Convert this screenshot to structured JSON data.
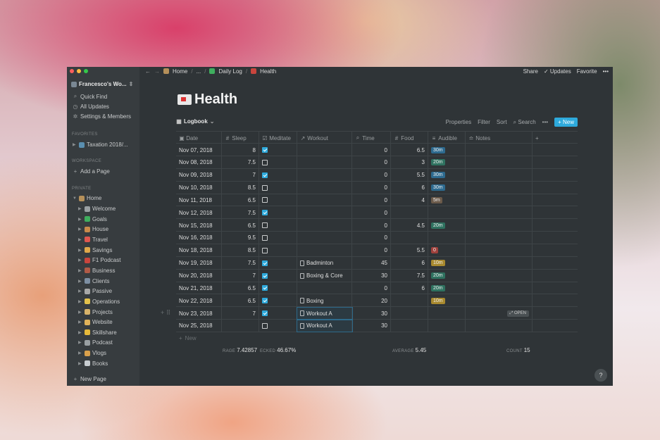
{
  "sidebar": {
    "workspace": "Francesco's Wo...",
    "top_items": [
      {
        "label": "Quick Find"
      },
      {
        "label": "All Updates"
      },
      {
        "label": "Settings & Members"
      }
    ],
    "favorites_heading": "FAVORITES",
    "favorites": [
      {
        "label": "Taxation 2018/..."
      }
    ],
    "workspace_heading": "WORKSPACE",
    "add_page": "Add a Page",
    "private_heading": "PRIVATE",
    "home": "Home",
    "private_items": [
      {
        "label": "Welcome",
        "color": "#9aa0a3"
      },
      {
        "label": "Goals",
        "color": "#3fae5e"
      },
      {
        "label": "House",
        "color": "#c98a4b"
      },
      {
        "label": "Travel",
        "color": "#e0574f"
      },
      {
        "label": "Savings",
        "color": "#e0a84a"
      },
      {
        "label": "F1 Podcast",
        "color": "#c9453d"
      },
      {
        "label": "Business",
        "color": "#b05a47"
      },
      {
        "label": "Clients",
        "color": "#7d8fa3"
      },
      {
        "label": "Passive",
        "color": "#a8a8a8"
      },
      {
        "label": "Operations",
        "color": "#e3c14b"
      },
      {
        "label": "Projects",
        "color": "#d8b36a"
      },
      {
        "label": "Website",
        "color": "#e0b25a"
      },
      {
        "label": "Skillshare",
        "color": "#e6b93a"
      },
      {
        "label": "Podcast",
        "color": "#9aa0a3"
      },
      {
        "label": "Vlogs",
        "color": "#d9a04b"
      },
      {
        "label": "Books",
        "color": "#c7ccd0"
      }
    ],
    "new_page": "New Page"
  },
  "topbar": {
    "breadcrumbs": [
      "Home",
      "...",
      "Daily Log",
      "Health"
    ],
    "share": "Share",
    "updates": "Updates",
    "favorite": "Favorite",
    "more": "•••"
  },
  "page": {
    "title": "Health"
  },
  "view": {
    "name": "Logbook",
    "properties": "Properties",
    "filter": "Filter",
    "sort": "Sort",
    "search": "Search",
    "more": "•••",
    "new": "New"
  },
  "table": {
    "headers": [
      "Date",
      "Sleep",
      "Meditate",
      "Workout",
      "Time",
      "Food",
      "Audible",
      "Notes",
      "+"
    ],
    "rows": [
      {
        "date": "Nov 07, 2018",
        "sleep": "8",
        "meditate": true,
        "workout": "",
        "time": "0",
        "food": "6.5",
        "audible": "30m"
      },
      {
        "date": "Nov 08, 2018",
        "sleep": "7.5",
        "meditate": false,
        "workout": "",
        "time": "0",
        "food": "3",
        "audible": "20m"
      },
      {
        "date": "Nov 09, 2018",
        "sleep": "7",
        "meditate": true,
        "workout": "",
        "time": "0",
        "food": "5.5",
        "audible": "30m"
      },
      {
        "date": "Nov 10, 2018",
        "sleep": "8.5",
        "meditate": false,
        "workout": "",
        "time": "0",
        "food": "6",
        "audible": "30m"
      },
      {
        "date": "Nov 11, 2018",
        "sleep": "6.5",
        "meditate": false,
        "workout": "",
        "time": "0",
        "food": "4",
        "audible": "5m"
      },
      {
        "date": "Nov 12, 2018",
        "sleep": "7.5",
        "meditate": true,
        "workout": "",
        "time": "0",
        "food": "",
        "audible": ""
      },
      {
        "date": "Nov 15, 2018",
        "sleep": "6.5",
        "meditate": false,
        "workout": "",
        "time": "0",
        "food": "4.5",
        "audible": "20m"
      },
      {
        "date": "Nov 16, 2018",
        "sleep": "9.5",
        "meditate": false,
        "workout": "",
        "time": "0",
        "food": "",
        "audible": ""
      },
      {
        "date": "Nov 18, 2018",
        "sleep": "8.5",
        "meditate": false,
        "workout": "",
        "time": "0",
        "food": "5.5",
        "audible": "0"
      },
      {
        "date": "Nov 19, 2018",
        "sleep": "7.5",
        "meditate": true,
        "workout": "Badminton",
        "time": "45",
        "food": "6",
        "audible": "10m"
      },
      {
        "date": "Nov 20, 2018",
        "sleep": "7",
        "meditate": true,
        "workout": "Boxing & Core",
        "time": "30",
        "food": "7.5",
        "audible": "20m"
      },
      {
        "date": "Nov 21, 2018",
        "sleep": "6.5",
        "meditate": true,
        "workout": "",
        "time": "0",
        "food": "6",
        "audible": "20m"
      },
      {
        "date": "Nov 22, 2018",
        "sleep": "6.5",
        "meditate": true,
        "workout": "Boxing",
        "time": "20",
        "food": "",
        "audible": "10m"
      },
      {
        "date": "Nov 23, 2018",
        "sleep": "7",
        "meditate": true,
        "workout": "Workout A",
        "time": "30",
        "food": "",
        "audible": "",
        "open": "OPEN"
      },
      {
        "date": "Nov 25, 2018",
        "sleep": "",
        "meditate": false,
        "workout": "Workout A",
        "time": "30",
        "food": "",
        "audible": ""
      }
    ],
    "new_row": "New",
    "footer": [
      {
        "label": "RAGE",
        "value": "7.42857"
      },
      {
        "label": "ECKED",
        "value": "46.67%"
      },
      {
        "label": "AVERAGE",
        "value": "5.45"
      },
      {
        "label": "COUNT",
        "value": "15"
      }
    ]
  },
  "tag_colors": {
    "30m": "#2d6a8f",
    "20m": "#2f7260",
    "5m": "#6b5a4a",
    "0": "#a0413c",
    "10m": "#a8892e"
  },
  "help": "?"
}
